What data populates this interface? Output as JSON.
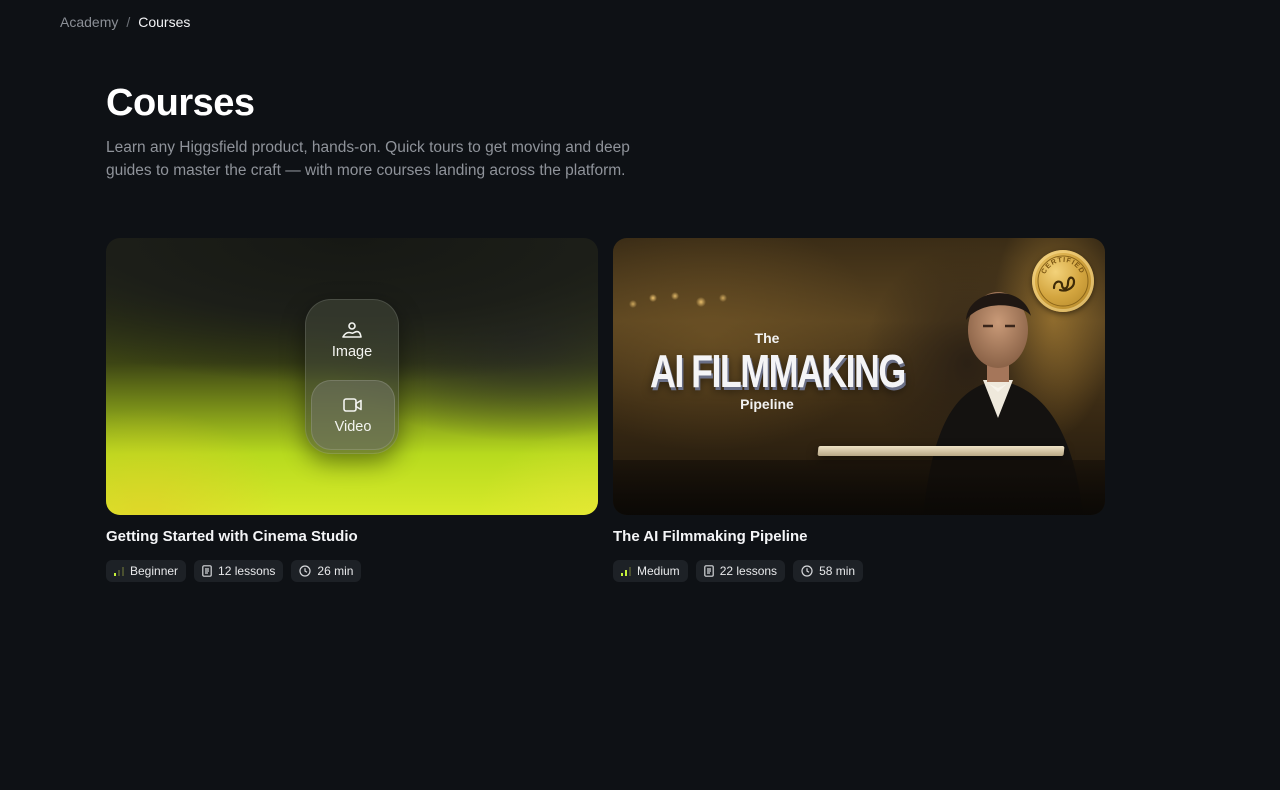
{
  "breadcrumb": {
    "root": "Academy",
    "separator": "/",
    "current": "Courses"
  },
  "page": {
    "title": "Courses",
    "subtitle": "Learn any Higgsfield product, hands-on. Quick tours to get moving and deep guides to master the craft — with more courses landing across the platform."
  },
  "courses": [
    {
      "title": "Getting Started with Cinema Studio",
      "thumbnail": {
        "modes": [
          "Image",
          "Video"
        ],
        "selected_mode": "Video",
        "icons": [
          "image-icon",
          "video-icon"
        ]
      },
      "level": "Beginner",
      "lessons": "12 lessons",
      "duration": "26 min"
    },
    {
      "title": "The AI Filmmaking Pipeline",
      "thumbnail": {
        "overlay_the": "The",
        "overlay_main": "AI FILMMAKING",
        "overlay_sub": "Pipeline",
        "badge_text": "CERTIFIED"
      },
      "level": "Medium",
      "lessons": "22 lessons",
      "duration": "58 min"
    }
  ],
  "colors": {
    "background": "#0e1115",
    "chip_background": "#1d2126",
    "level_bar_accent": "#c6f23a",
    "badge_gold": "#d4a640"
  },
  "icons": {
    "level": "signal-bars-icon",
    "lessons": "document-icon",
    "duration": "clock-icon"
  }
}
